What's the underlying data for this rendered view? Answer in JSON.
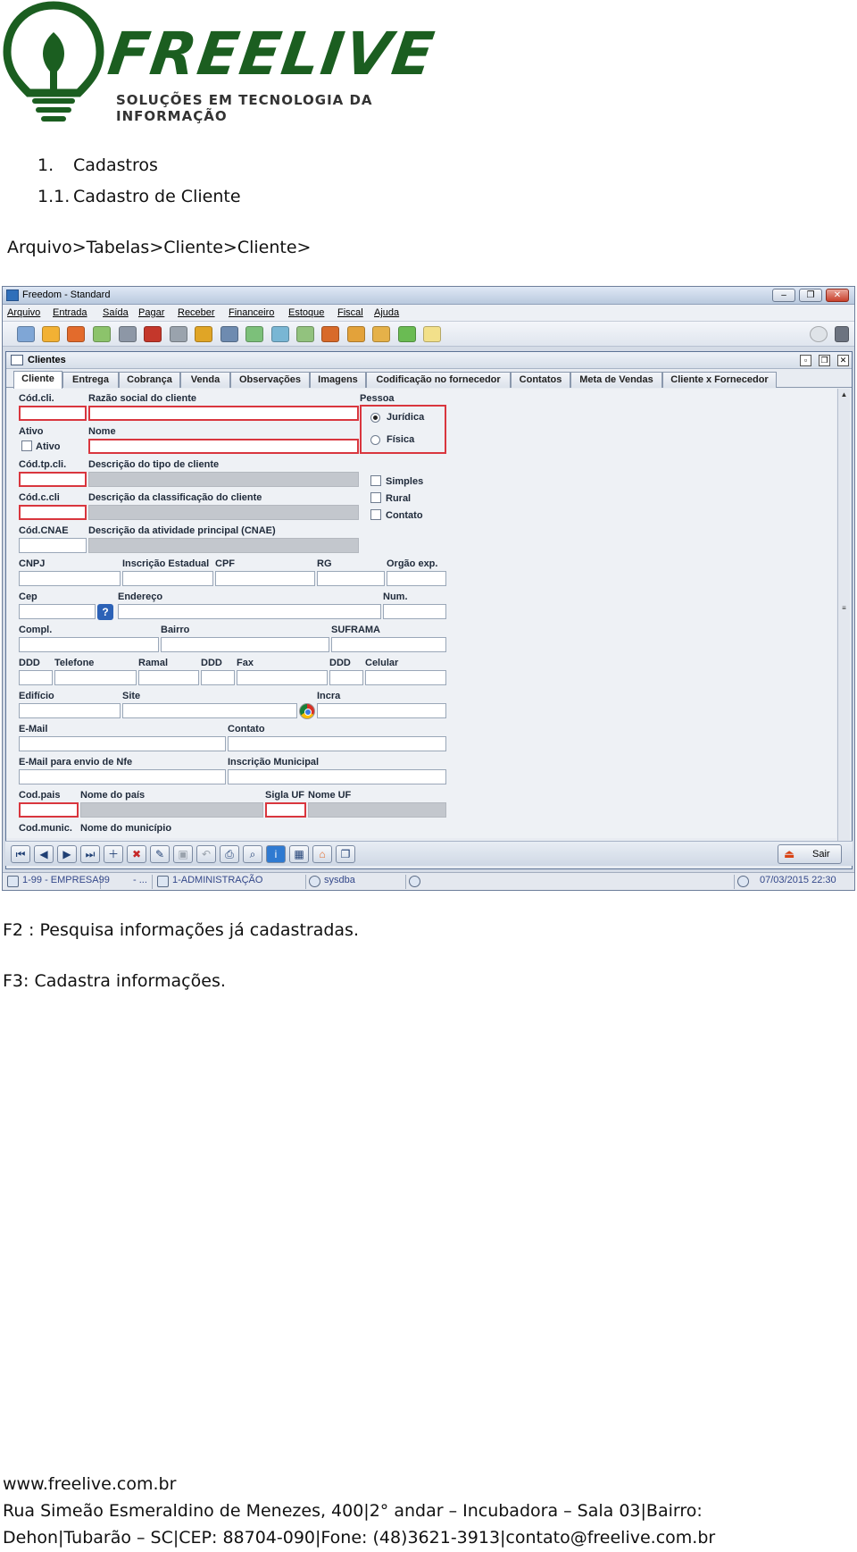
{
  "logo": {
    "brand": "FREELIVE",
    "tagline": "SOLUÇÕES EM TECNOLOGIA DA INFORMAÇÃO"
  },
  "doc": {
    "heading1_num": "1.",
    "heading1": "Cadastros",
    "heading2_num": "1.1.",
    "heading2": "Cadastro de Cliente",
    "path": "Arquivo>Tabelas>Cliente>Cliente>",
    "note_f2": "F2 : Pesquisa informações já cadastradas.",
    "note_f3": "F3: Cadastra informações."
  },
  "app": {
    "title": "Freedom - Standard",
    "menu": [
      "Arquivo",
      "Entrada",
      "Saída",
      "Pagar",
      "Receber",
      "Financeiro",
      "Estoque",
      "Fiscal",
      "Ajuda"
    ],
    "frame_title": "Clientes",
    "tabs": [
      "Cliente",
      "Entrega",
      "Cobrança",
      "Venda",
      "Observações",
      "Imagens",
      "Codificação no fornecedor",
      "Contatos",
      "Meta de Vendas",
      "Cliente x Fornecedor"
    ],
    "labels": {
      "cod_cli": "Cód.cli.",
      "razao": "Razão social do cliente",
      "pessoa": "Pessoa",
      "juridica": "Jurídica",
      "fisica": "Física",
      "ativo_head": "Ativo",
      "ativo_cb": "Ativo",
      "nome": "Nome",
      "cod_tp": "Cód.tp.cli.",
      "desc_tp": "Descrição do tipo de cliente",
      "simples": "Simples",
      "rural": "Rural",
      "contato_cb": "Contato",
      "cod_ccli": "Cód.c.cli",
      "desc_class": "Descrição da classificação do cliente",
      "cod_cnae": "Cód.CNAE",
      "desc_cnae": "Descrição da atividade principal (CNAE)",
      "cnpj": "CNPJ",
      "ie": "Inscrição Estadual",
      "cpf": "CPF",
      "rg": "RG",
      "orgao": "Orgão exp.",
      "cep": "Cep",
      "endereco": "Endereço",
      "num": "Num.",
      "compl": "Compl.",
      "bairro": "Bairro",
      "suframa": "SUFRAMA",
      "ddd1": "DDD",
      "telefone": "Telefone",
      "ramal": "Ramal",
      "ddd2": "DDD",
      "fax": "Fax",
      "ddd3": "DDD",
      "celular": "Celular",
      "edificio": "Edifício",
      "site": "Site",
      "incra": "Incra",
      "email": "E-Mail",
      "contato": "Contato",
      "email_nfe": "E-Mail para envio de Nfe",
      "im": "Inscrição Municipal",
      "cod_pais": "Cod.pais",
      "nome_pais": "Nome do país",
      "sigla_uf": "Sigla UF",
      "nome_uf": "Nome UF",
      "cod_munic": "Cod.munic.",
      "nome_munic": "Nome do município"
    },
    "pessoa_selected": "Jurídica",
    "help_glyph": "?",
    "sair": "Sair",
    "status": {
      "empresa": "1-99 - EMPRESA99",
      "empresa_suffix": "- ...",
      "admin": "1-ADMINISTRAÇÃO",
      "user": "sysdba",
      "datetime": "07/03/2015 22:30"
    }
  },
  "footer": {
    "site": "www.freelive.com.br",
    "line1": "Rua Simeão Esmeraldino de Menezes, 400|2° andar – Incubadora – Sala 03|Bairro:",
    "line2": "Dehon|Tubarão – SC|CEP: 88704-090|Fone: (48)3621-3913|contato@freelive.com.br"
  },
  "colors": {
    "brand_green": "#1b5e20",
    "required_border": "#d9363e",
    "window_blue": "#5b7295"
  }
}
